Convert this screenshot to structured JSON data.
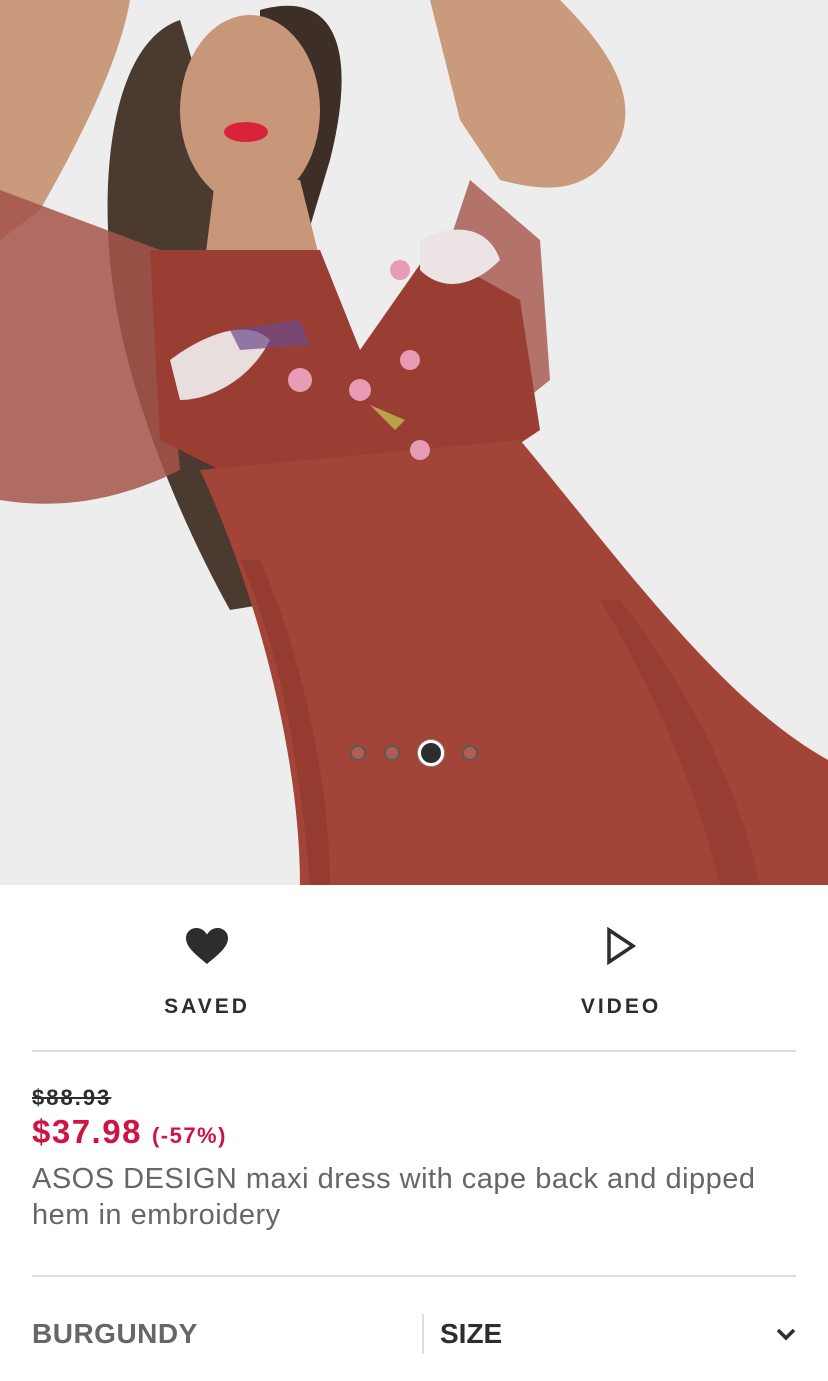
{
  "gallery": {
    "image_alt": "Model wearing burgundy maxi dress with embroidered cape",
    "dots": [
      {
        "active": false
      },
      {
        "active": false
      },
      {
        "active": true
      },
      {
        "active": false
      }
    ]
  },
  "actions": {
    "saved": {
      "label": "SAVED",
      "icon": "heart-filled-icon"
    },
    "video": {
      "label": "VIDEO",
      "icon": "play-outline-icon"
    }
  },
  "product": {
    "old_price": "$88.93",
    "price": "$37.98",
    "discount": "(-57%)",
    "title": "ASOS DESIGN maxi dress with cape back and dipped hem in embroidery"
  },
  "options": {
    "colour": "BURGUNDY",
    "size_label": "SIZE",
    "size_icon": "chevron-down-icon"
  },
  "colors": {
    "sale": "#d01345",
    "text": "#2d2d2d",
    "muted": "#666666",
    "dress": "#9e3f35"
  }
}
